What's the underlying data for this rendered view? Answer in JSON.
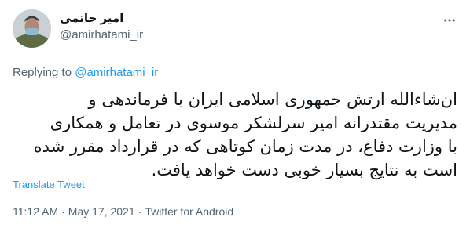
{
  "author": {
    "display_name": "امیر حاتمی",
    "handle": "@amirhatami_ir"
  },
  "more_icon": "more-horizontal-icon",
  "replying": {
    "prefix": "Replying to ",
    "mention": "@amirhatami_ir"
  },
  "tweet": {
    "lines": [
      "ان‌شاءالله ارتش جمهوری اسلامی ایران با فرماندهی و",
      "مدیریت مقتدرانه امیر سرلشکر موسوی در تعامل و همکاری",
      "با وزارت دفاع، در مدت زمان کوتاهی که در قرارداد مقرر شده",
      "است به نتایج بسیار خوبی دست خواهد یافت."
    ]
  },
  "translate_label": "Translate Tweet",
  "meta": {
    "time": "11:12 AM",
    "dot1": "·",
    "date": "May 17, 2021",
    "dot2": "·",
    "source": "Twitter for Android"
  },
  "colors": {
    "text": "#0f1419",
    "secondary": "#536471",
    "link": "#1d9bf0"
  }
}
